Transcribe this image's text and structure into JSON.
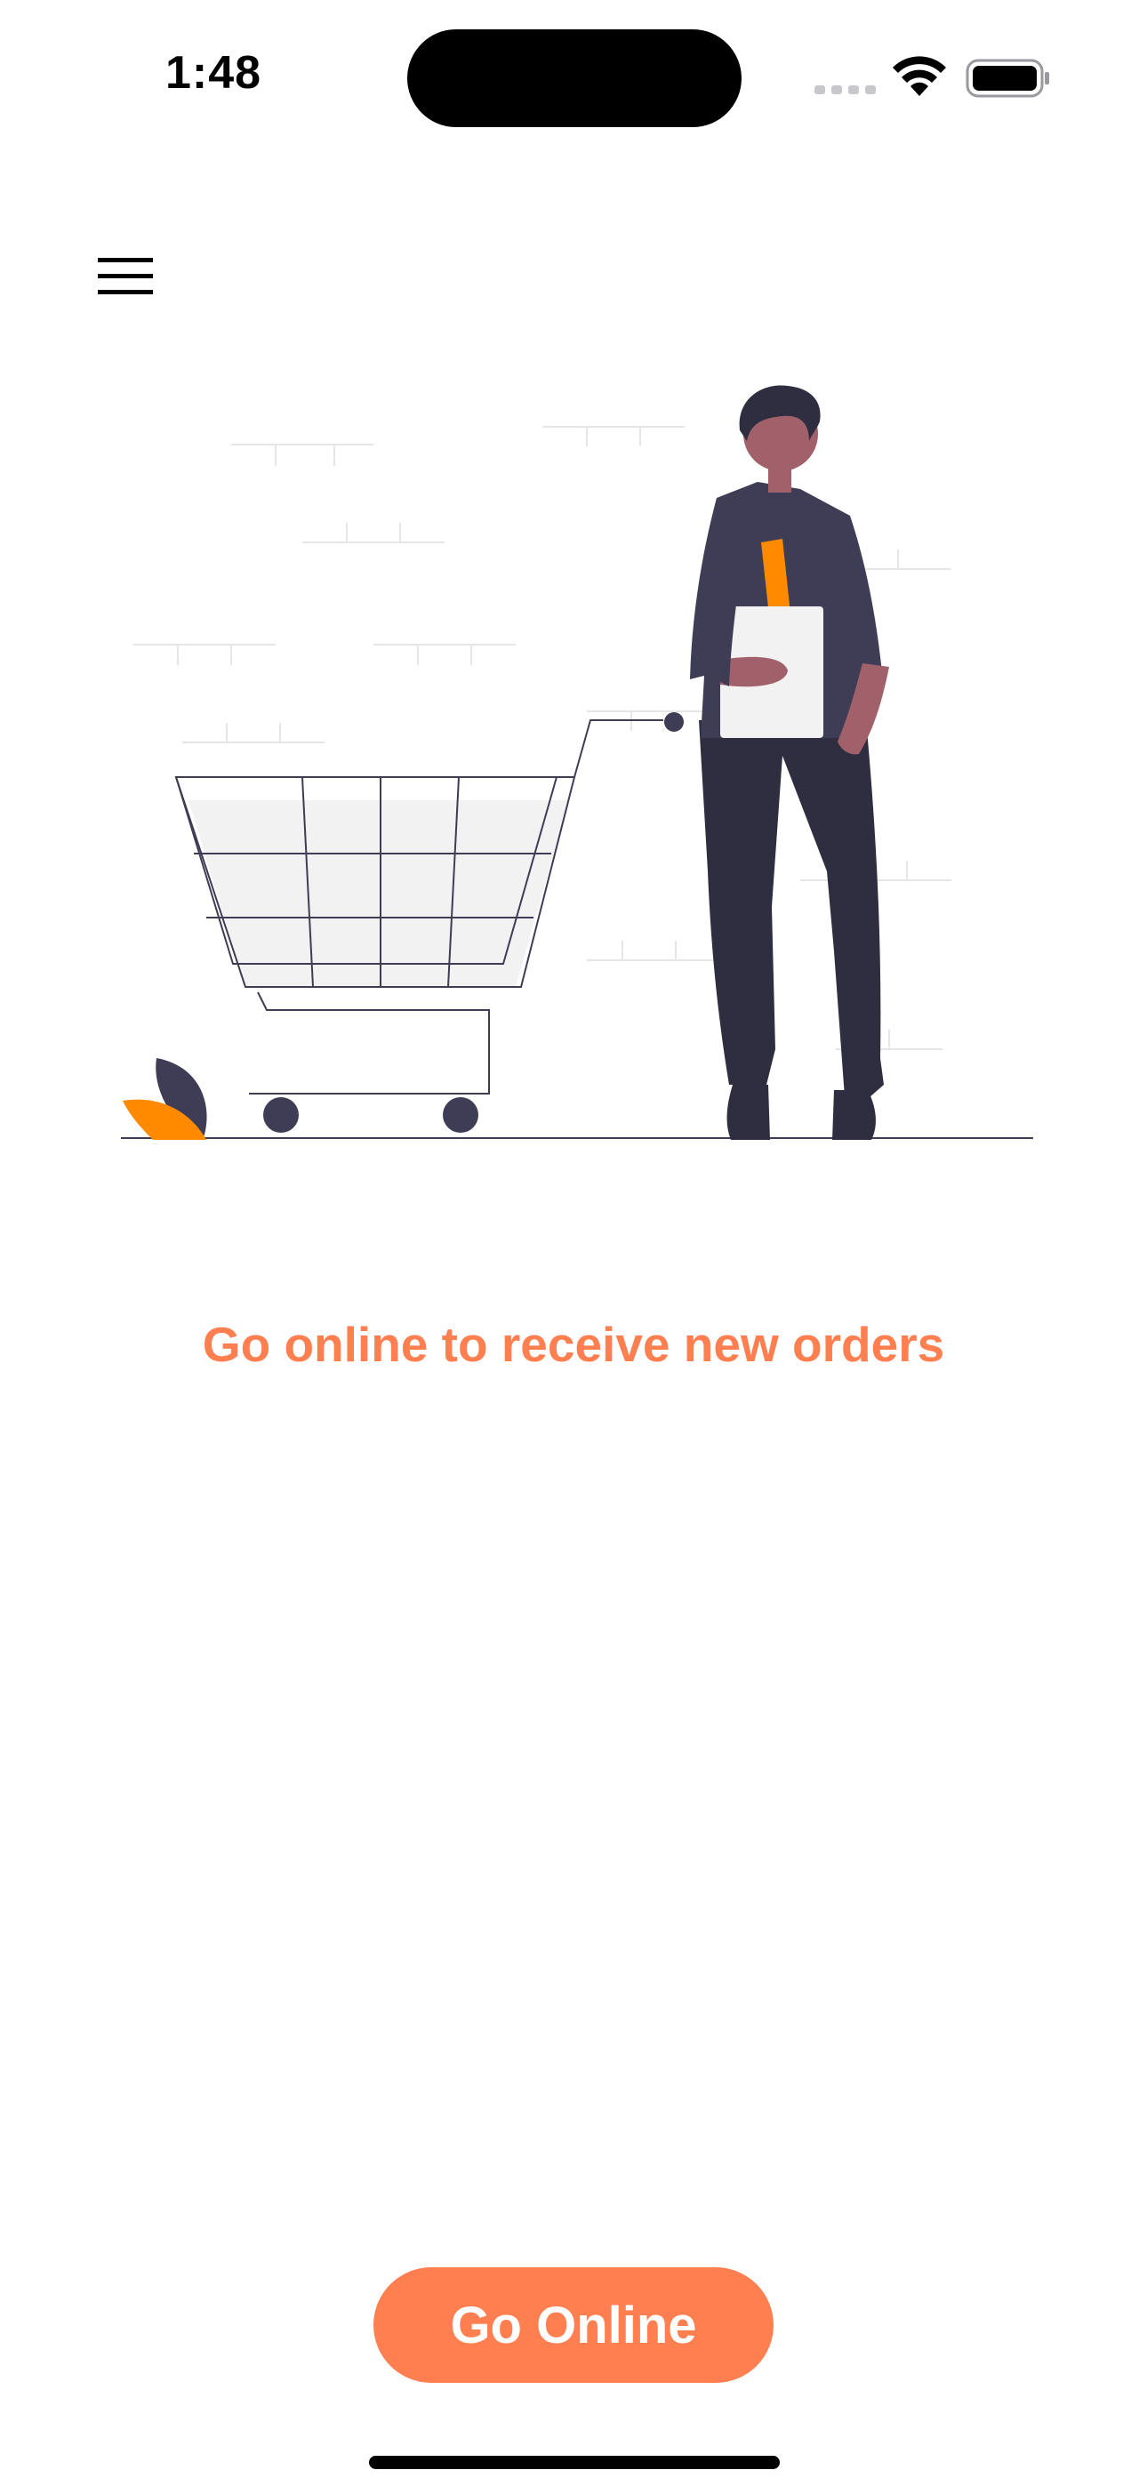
{
  "status_bar": {
    "time": "1:48",
    "signal_icon": "cellular-signal-icon",
    "wifi_icon": "wifi-icon",
    "battery_icon": "battery-icon"
  },
  "header": {
    "menu_icon": "hamburger-menu-icon"
  },
  "illustration": {
    "description_icon": "shopping-cart-person-illustration",
    "colors": {
      "dark": "#3F3D56",
      "accent": "#FF8A00",
      "skin": "#A0616A",
      "paper": "#F2F2F2",
      "brick": "#E6E6E6"
    }
  },
  "main": {
    "headline": "Go online to receive new orders"
  },
  "actions": {
    "go_online_label": "Go Online"
  },
  "theme": {
    "accent": "#FF7F50"
  }
}
